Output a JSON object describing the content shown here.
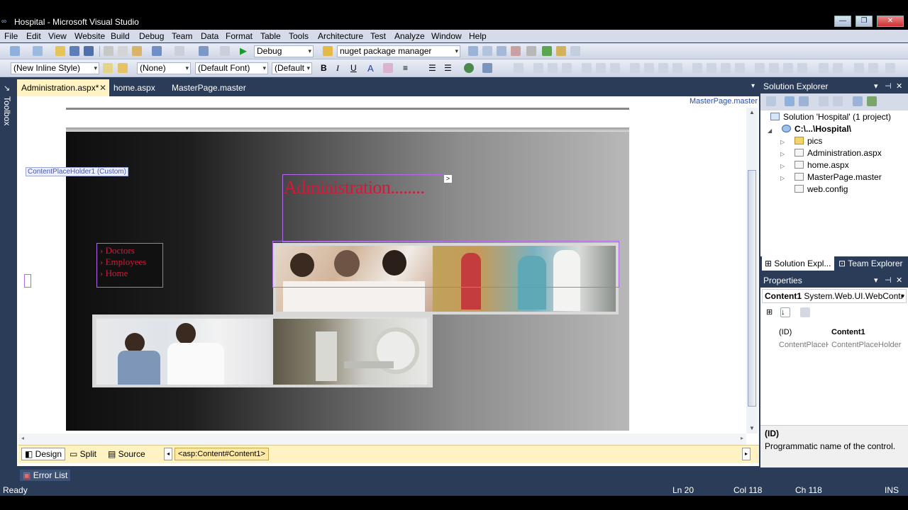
{
  "window": {
    "title": "Hospital - Microsoft Visual Studio",
    "buttons": [
      "—",
      "❐",
      "✕"
    ]
  },
  "menu": [
    "File",
    "Edit",
    "View",
    "Website",
    "Build",
    "Debug",
    "Team",
    "Data",
    "Format",
    "Table",
    "Tools",
    "Architecture",
    "Test",
    "Analyze",
    "Window",
    "Help"
  ],
  "toolbar1": {
    "config": "Debug",
    "search": "nuget package manager"
  },
  "toolbar2": {
    "style": "(New Inline Style)",
    "block": "(None)",
    "font": "(Default Font)",
    "size": "(Default"
  },
  "toolbox": {
    "label": "Toolbox"
  },
  "tabs": [
    {
      "label": "Administration.aspx*",
      "active": true
    },
    {
      "label": "home.aspx",
      "active": false
    },
    {
      "label": "MasterPage.master",
      "active": false
    }
  ],
  "tab_close": "✕",
  "master_link": "MasterPage.master",
  "designer": {
    "cph_tag": "ContentPlaceHolder1 (Custom)",
    "admin_title": "Administration........",
    "smart_tag": ">",
    "nav_links": [
      "Doctors",
      "Employees",
      "Home"
    ]
  },
  "view_tabs": {
    "design": "Design",
    "split": "Split",
    "source": "Source"
  },
  "breadcrumb": "<asp:Content#Content1>",
  "solution_explorer": {
    "title": "Solution Explorer",
    "solution": "Solution 'Hospital' (1 project)",
    "project": "C:\\...\\Hospital\\",
    "items": [
      "pics",
      "Administration.aspx",
      "home.aspx",
      "MasterPage.master",
      "web.config"
    ],
    "tabs": [
      "Solution Expl...",
      "Team Explorer"
    ]
  },
  "properties": {
    "title": "Properties",
    "object": "Content1",
    "object_type": "System.Web.UI.WebContr",
    "rows": [
      {
        "name": "(ID)",
        "value": "Content1"
      },
      {
        "name": "ContentPlaceH",
        "value": "ContentPlaceHolder"
      }
    ],
    "desc_title": "(ID)",
    "desc_text": "Programmatic name of the control."
  },
  "error_list": "Error List",
  "status": {
    "state": "Ready",
    "ln": "Ln 20",
    "col": "Col 118",
    "ch": "Ch 118",
    "mode": "INS"
  }
}
